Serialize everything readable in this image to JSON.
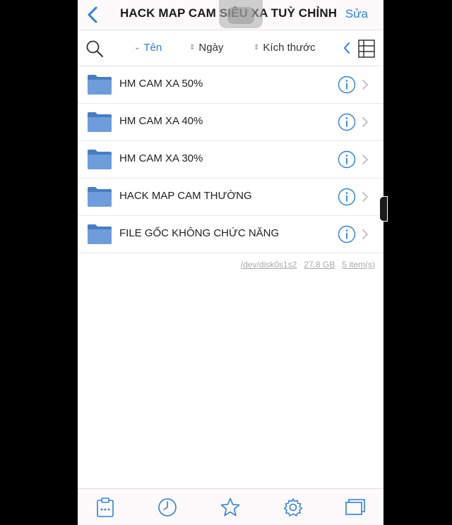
{
  "nav": {
    "title": "HACK MAP CAM SIÊU XA TUỲ CHỈNH",
    "edit_label": "Sửa"
  },
  "sort": {
    "name_label": "Tên",
    "date_label": "Ngày",
    "size_label": "Kích thước"
  },
  "folders": [
    {
      "name": "HM CAM XA 50%"
    },
    {
      "name": "HM CAM XA 40%"
    },
    {
      "name": "HM CAM XA 30%"
    },
    {
      "name": "HACK MAP CAM THƯỜNG"
    },
    {
      "name": "FILE GỐC KHÔNG CHỨC NĂNG"
    }
  ],
  "footer": {
    "disk": "/dev/disk0s1s2",
    "size": "27.8 GB",
    "items": "5 item(s)"
  },
  "colors": {
    "accent": "#2f7fd6",
    "folder": "#6d9edb",
    "folder_dark": "#4a7cc0"
  },
  "tabs": [
    "clipboard-icon",
    "clock-icon",
    "star-icon",
    "gear-icon",
    "windows-icon"
  ]
}
